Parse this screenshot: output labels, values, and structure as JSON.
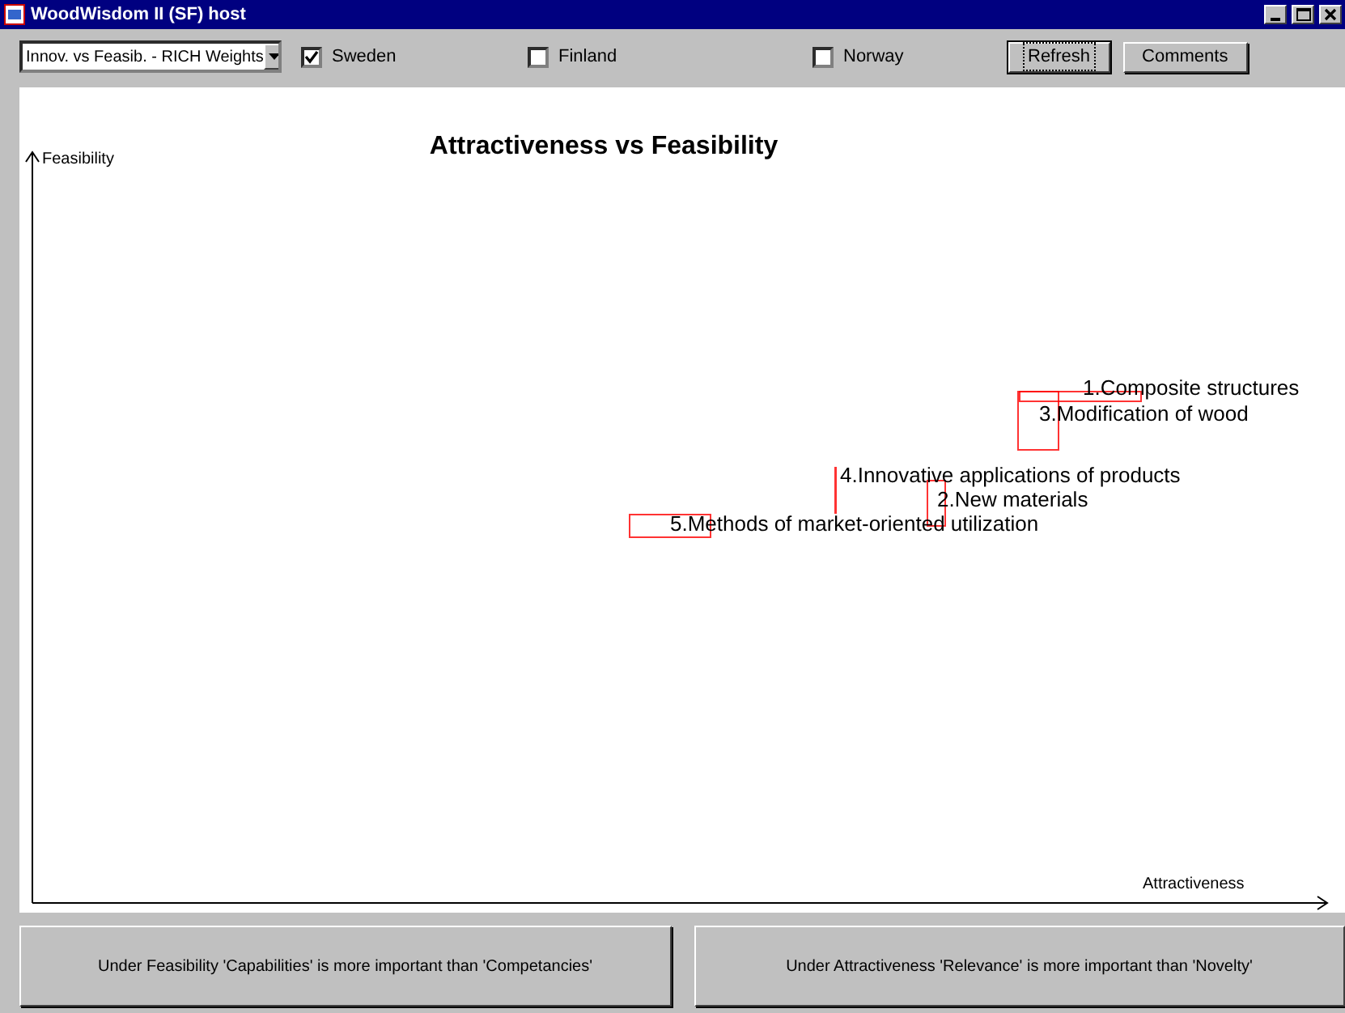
{
  "window": {
    "title": "WoodWisdom II (SF) host"
  },
  "toolbar": {
    "view_select": {
      "value": "Innov. vs Feasib. - RICH Weights"
    },
    "countries": [
      {
        "label": "Sweden",
        "checked": true
      },
      {
        "label": "Finland",
        "checked": false
      },
      {
        "label": "Norway",
        "checked": false
      }
    ],
    "buttons": [
      {
        "label": "Refresh",
        "focused": true
      },
      {
        "label": "Comments",
        "focused": false
      }
    ]
  },
  "chart": {
    "title": "Attractiveness vs Feasibility",
    "xlabel": "Attractiveness",
    "ylabel": "Feasibility",
    "items": [
      {
        "label": "1.Composite structures"
      },
      {
        "label": "2.New materials"
      },
      {
        "label": "3.Modification of wood"
      },
      {
        "label": "4.Innovative applications of products"
      },
      {
        "label": "5.Methods of market-oriented utilization"
      }
    ]
  },
  "notes": [
    "Under Feasibility 'Capabilities' is more important than 'Competancies'",
    "Under Attractiveness 'Relevance' is more important than 'Novelty'"
  ]
}
